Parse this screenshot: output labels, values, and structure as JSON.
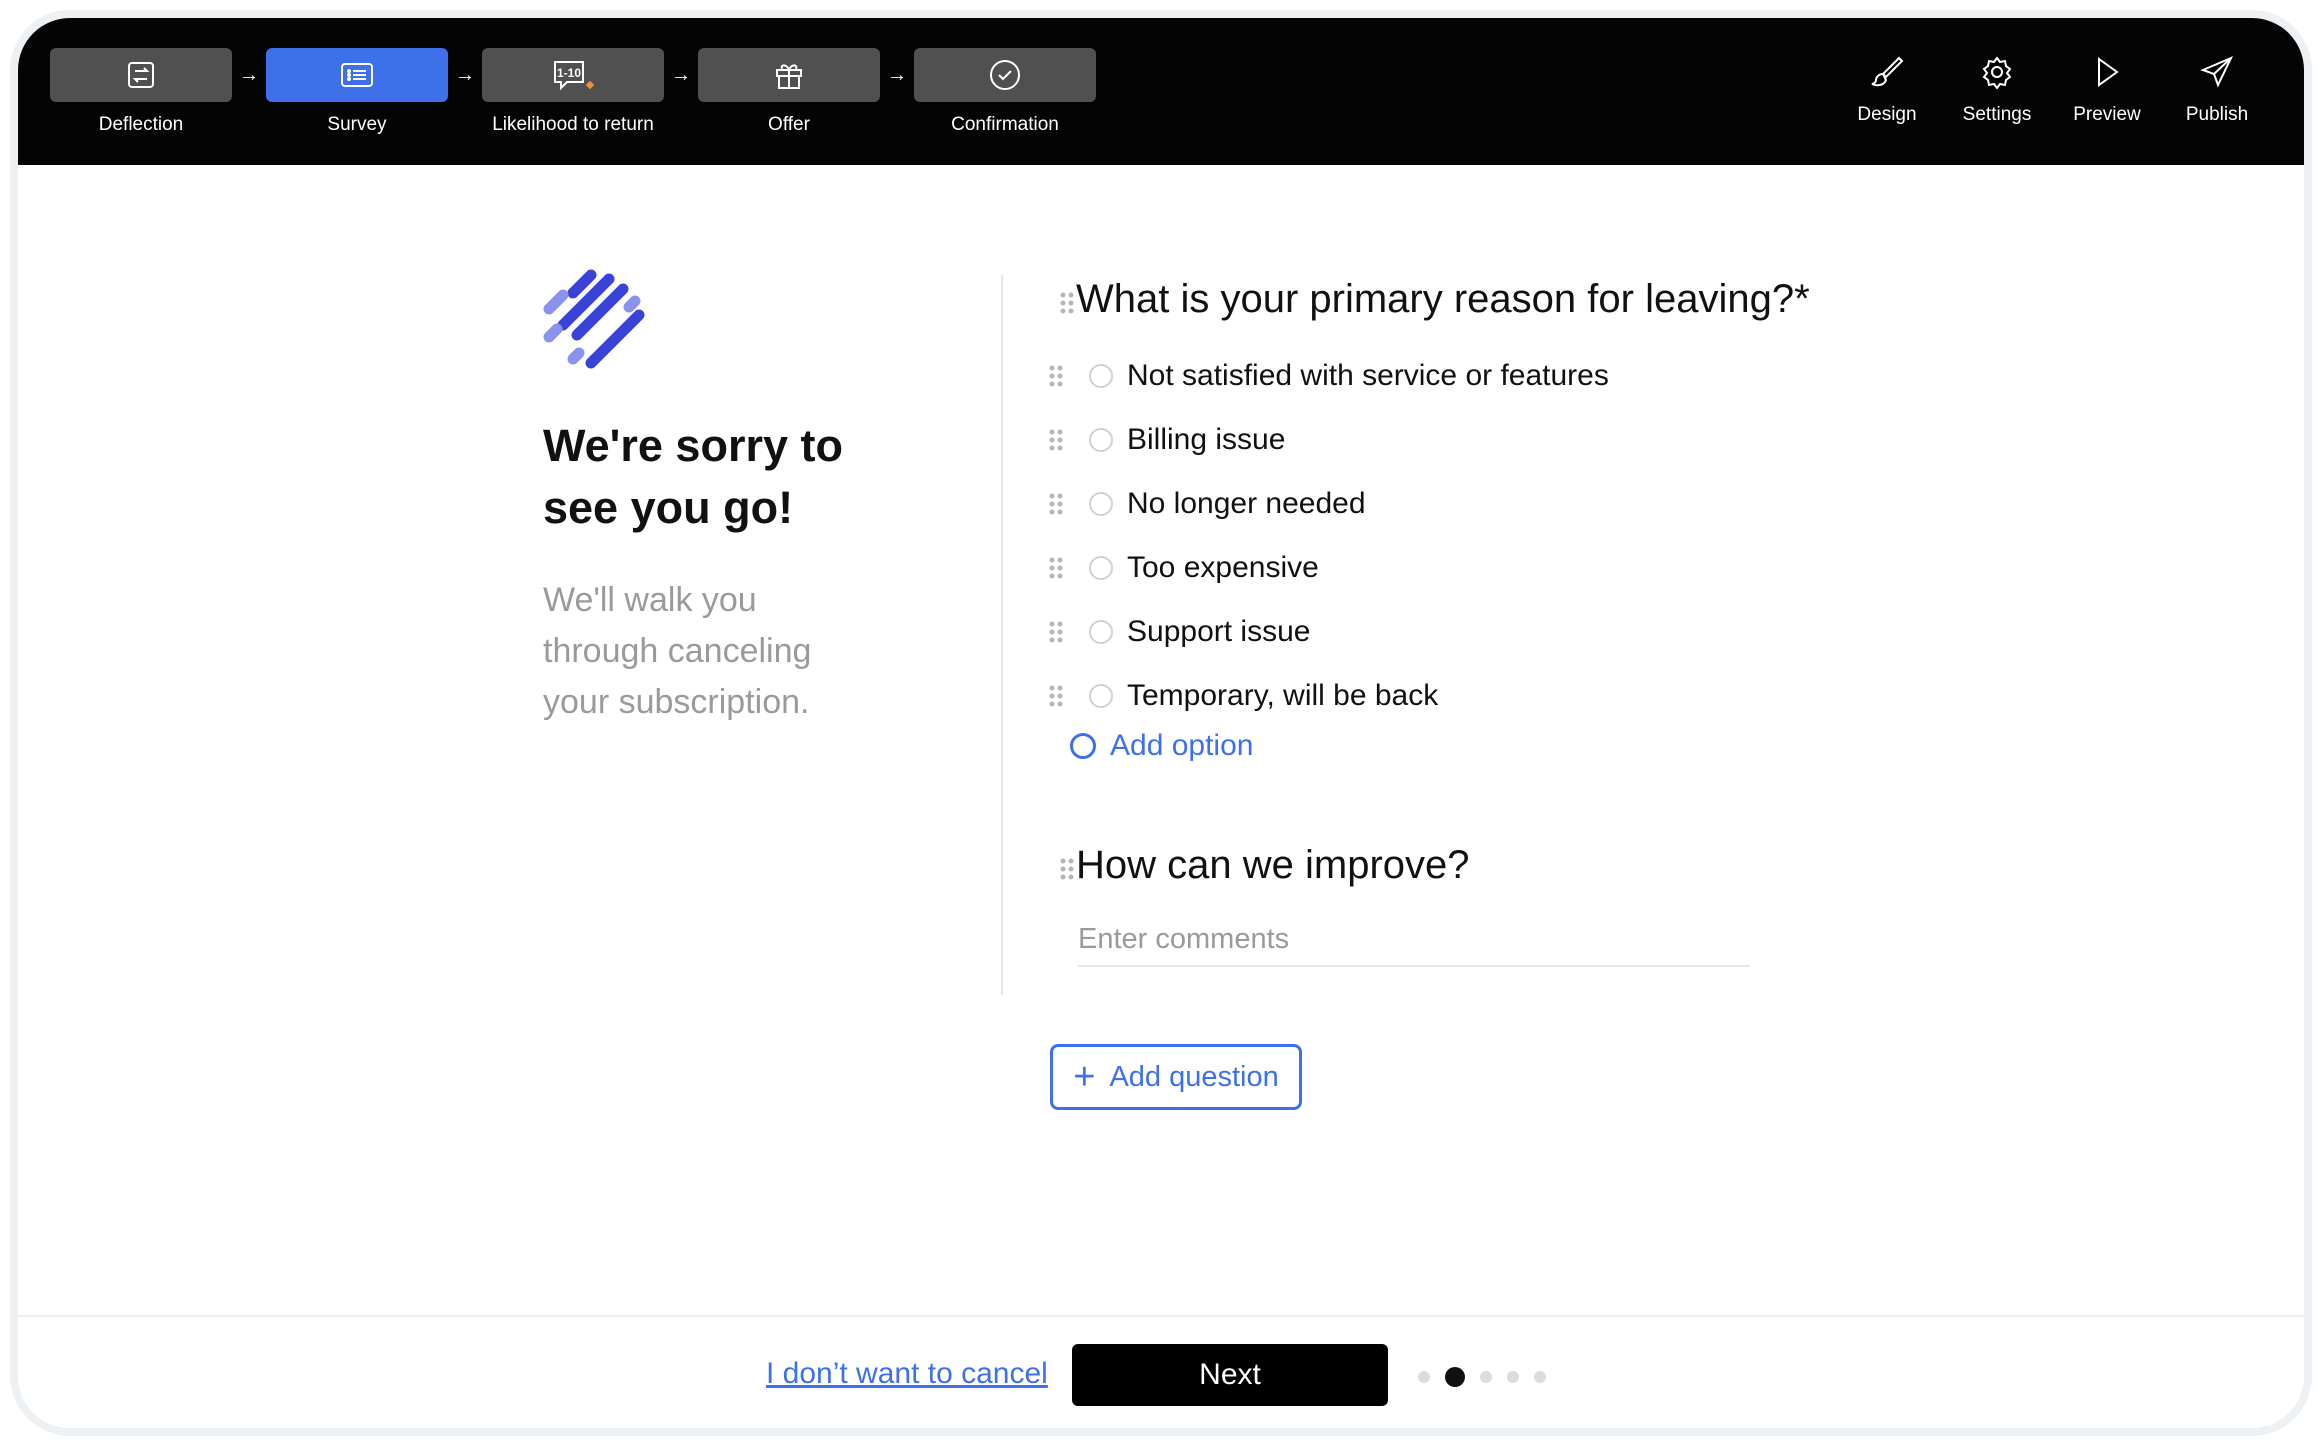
{
  "steps": [
    {
      "label": "Deflection",
      "icon": "swap-icon",
      "active": false
    },
    {
      "label": "Survey",
      "icon": "list-icon",
      "active": true
    },
    {
      "label": "Likelihood to return",
      "icon": "rating-chat-icon",
      "icon_text": "1-10",
      "active": false
    },
    {
      "label": "Offer",
      "icon": "gift-icon",
      "active": false
    },
    {
      "label": "Confirmation",
      "icon": "check-circle-icon",
      "active": false
    }
  ],
  "tools": [
    {
      "label": "Design",
      "icon": "brush-icon"
    },
    {
      "label": "Settings",
      "icon": "gear-icon"
    },
    {
      "label": "Preview",
      "icon": "play-icon"
    },
    {
      "label": "Publish",
      "icon": "send-icon"
    }
  ],
  "intro": {
    "headline": "We're sorry to see you go!",
    "subtext": "We'll walk you through canceling your subscription."
  },
  "questions": [
    {
      "title": "What is your primary reason for leaving?*",
      "options": [
        "Not satisfied with service or features",
        "Billing issue",
        "No longer needed",
        "Too expensive",
        "Support issue",
        "Temporary, will be back"
      ],
      "add_option_label": "Add option"
    },
    {
      "title": "How can we improve?",
      "placeholder": "Enter comments"
    }
  ],
  "add_question_label": "Add question",
  "footer": {
    "cancel_link": "I don’t want to cancel",
    "next_label": "Next",
    "page_count": 5,
    "current_page": 2
  },
  "colors": {
    "accent": "#3f70ec",
    "topbar": "#040404",
    "step_inactive": "#505050",
    "logo_dark": "#3a43d8",
    "logo_light": "#8a92ee"
  }
}
